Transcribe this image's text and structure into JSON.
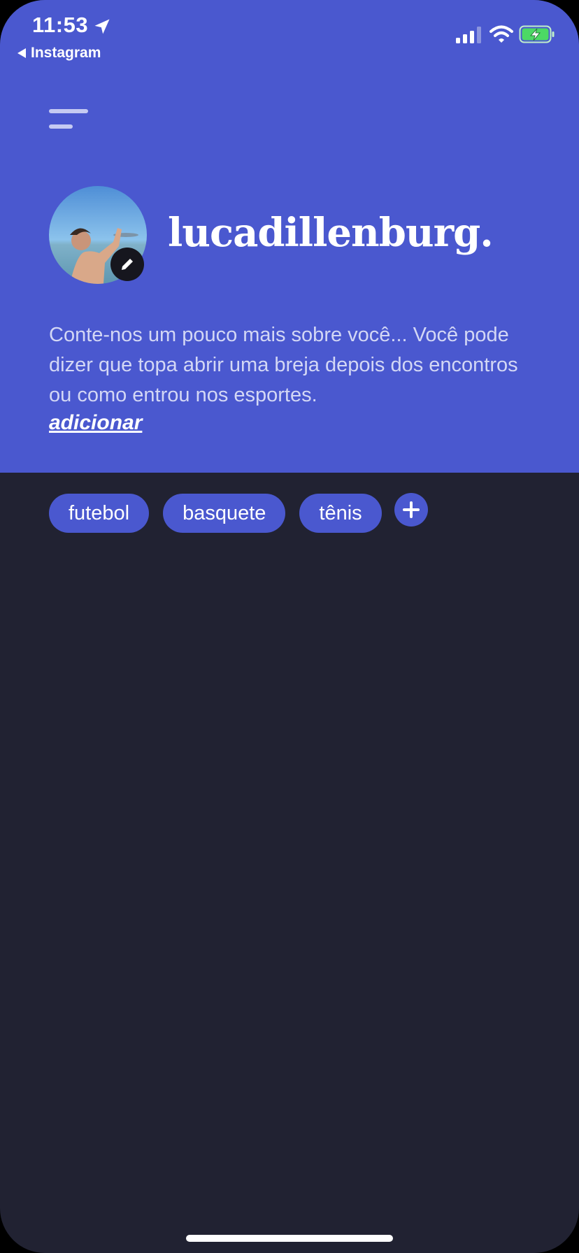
{
  "status_bar": {
    "time": "11:53",
    "back_label": "Instagram",
    "battery_color": "#4CD964"
  },
  "profile": {
    "username": "lucadillenburg.",
    "bio": "Conte-nos um pouco mais sobre você... Você pode dizer que topa abrir uma breja depois dos encontros ou como entrou nos esportes.",
    "add_link": "adicionar"
  },
  "tags": [
    "futebol",
    "basquete",
    "tênis"
  ],
  "colors": {
    "accent": "#4A58CF",
    "background": "#212232",
    "text": "#FFFFFF"
  },
  "icons": {
    "menu": "hamburger-icon",
    "edit": "pencil-icon",
    "add": "plus-icon",
    "location": "location-arrow-icon",
    "back": "back-triangle-icon"
  }
}
